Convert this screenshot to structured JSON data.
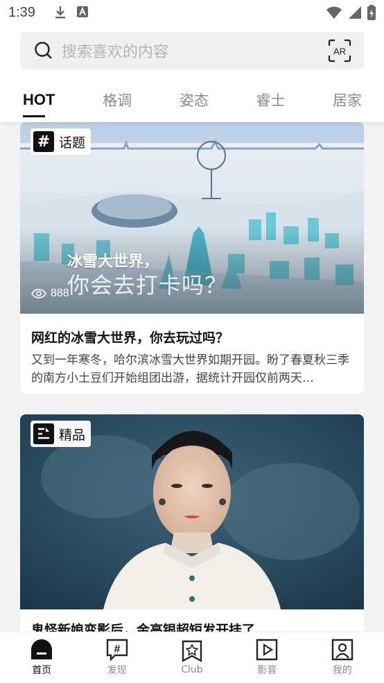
{
  "status_bar": {
    "time": "1:39"
  },
  "search": {
    "placeholder": "搜索喜欢的内容"
  },
  "tabs": [
    {
      "label": "HOT"
    },
    {
      "label": "格调"
    },
    {
      "label": "姿态"
    },
    {
      "label": "睿士"
    },
    {
      "label": "居家"
    }
  ],
  "cards": [
    {
      "badge": "话题",
      "image_title_line1": "冰雪大世界，",
      "image_title_line2": "你会去打卡吗？",
      "views": "888",
      "title": "网红的冰雪大世界，你去玩过吗？",
      "desc": "又到一年寒冬，哈尔滨冰雪大世界如期开园。盼了春夏秋三季的南方小土豆们开始组团出游，据统计开园仅前两天…"
    },
    {
      "badge": "精品",
      "title": "鬼怪新娘变影后，金高银超短发开挂了"
    }
  ],
  "bottom_nav": [
    {
      "label": "首页",
      "icon": "home-icon"
    },
    {
      "label": "发现",
      "icon": "discover-icon"
    },
    {
      "label": "Club",
      "icon": "club-icon"
    },
    {
      "label": "影音",
      "icon": "video-icon"
    },
    {
      "label": "我的",
      "icon": "profile-icon"
    }
  ],
  "colors": {
    "active": "#111111",
    "inactive": "#8a8a8a",
    "background": "#f2f2f2"
  }
}
